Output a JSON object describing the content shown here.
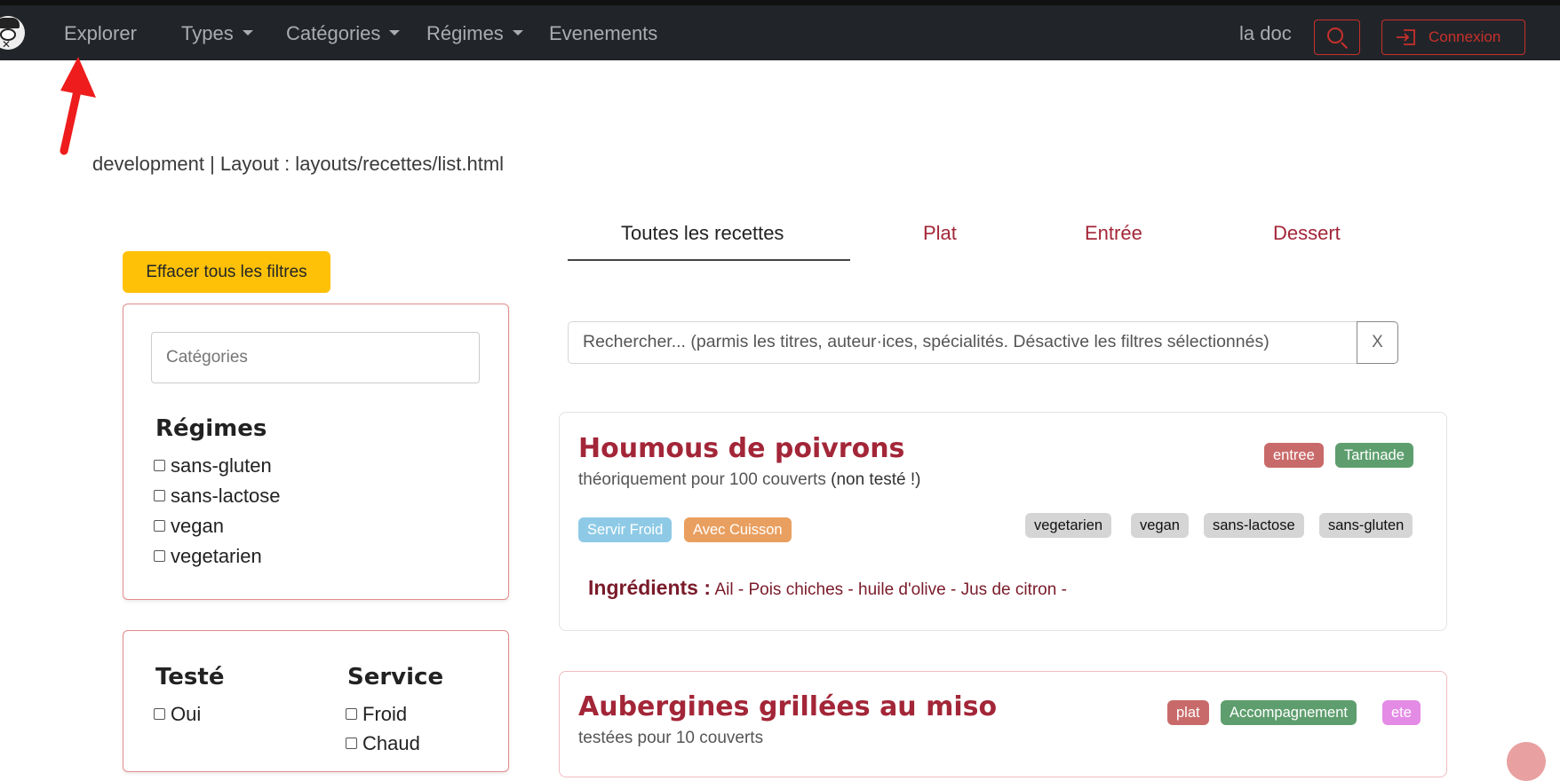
{
  "navbar": {
    "items": [
      {
        "label": "Explorer"
      },
      {
        "label": "Types"
      },
      {
        "label": "Catégories"
      },
      {
        "label": "Régimes"
      },
      {
        "label": "Evenements"
      }
    ],
    "doc_link": "la doc",
    "login_label": "Connexion",
    "icons": {
      "search": "search-icon",
      "login": "login-icon",
      "logo": "chef-logo"
    }
  },
  "dev_info": "development | Layout : layouts/recettes/list.html",
  "tabs": [
    {
      "label": "Toutes les recettes"
    },
    {
      "label": "Plat"
    },
    {
      "label": "Entrée"
    },
    {
      "label": "Dessert"
    }
  ],
  "filters": {
    "clear_label": "Effacer tous les filtres",
    "categories_placeholder": "Catégories",
    "regimes_title": "Régimes",
    "regimes": [
      "sans-gluten",
      "sans-lactose",
      "vegan",
      "vegetarien"
    ],
    "teste_title": "Testé",
    "teste_options": [
      "Oui"
    ],
    "service_title": "Service",
    "service_options": [
      "Froid",
      "Chaud"
    ]
  },
  "search": {
    "placeholder": "Rechercher...  (parmis les titres, auteur·ices, spécialités. Désactive les filtres sélectionnés)",
    "clear_label": "X"
  },
  "recipes": [
    {
      "title": "Houmous de poivrons",
      "subtitle": "théoriquement pour 100 couverts",
      "note": "(non testé !)",
      "type_badges": [
        "entree",
        "Tartinade"
      ],
      "service_badges": [
        "Servir Froid",
        "Avec Cuisson"
      ],
      "diet_badges": [
        "vegetarien",
        "vegan",
        "sans-lactose",
        "sans-gluten"
      ],
      "ingredients_label": "Ingrédients :",
      "ingredients": "Ail - Pois chiches - huile d'olive - Jus de citron -"
    },
    {
      "title": "Aubergines grillées au miso",
      "subtitle": "testées pour 10 couverts",
      "type_badges": [
        "plat",
        "Accompagnement",
        "ete"
      ]
    }
  ],
  "colors": {
    "navbar": "#212529",
    "accent_red": "#a32638",
    "warning": "#ffc107",
    "badge_red": "#c96a6a",
    "badge_green": "#5e9e6e",
    "badge_blue": "#8ecae6",
    "badge_orange": "#e99f5f",
    "badge_gray": "#d5d5d5",
    "badge_pink": "#e48be6"
  }
}
